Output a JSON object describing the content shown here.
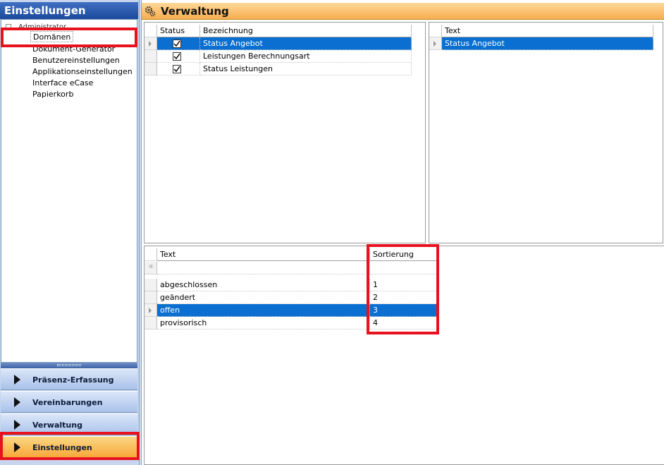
{
  "left": {
    "title": "Einstellungen",
    "tree_root": "Administrator",
    "tree_items": [
      "Domänen",
      "Dokument-Generator",
      "Benutzereinstellungen",
      "Applikationseinstellungen",
      "Interface eCase",
      "Papierkorb"
    ],
    "nav": [
      "Präsenz-Erfassung",
      "Vereinbarungen",
      "Verwaltung",
      "Einstellungen"
    ]
  },
  "right": {
    "title": "Verwaltung",
    "domains_grid": {
      "columns": [
        "Status",
        "Bezeichnung"
      ],
      "rows": [
        {
          "checked": true,
          "name": "Status Angebot"
        },
        {
          "checked": true,
          "name": "Leistungen Berechnungsart"
        },
        {
          "checked": true,
          "name": "Status Leistungen"
        }
      ]
    },
    "text_grid": {
      "columns": [
        "Text"
      ],
      "rows": [
        "Status Angebot"
      ]
    },
    "values_grid": {
      "columns": [
        "Text",
        "Sortierung"
      ],
      "rows": [
        {
          "text": "abgeschlossen",
          "sort": "1"
        },
        {
          "text": "geändert",
          "sort": "2"
        },
        {
          "text": "offen",
          "sort": "3"
        },
        {
          "text": "provisorisch",
          "sort": "4"
        }
      ]
    }
  },
  "colors": {
    "selection": "#0a6fd1",
    "highlight": "#e8121e",
    "active_nav": "#f7a83a"
  }
}
